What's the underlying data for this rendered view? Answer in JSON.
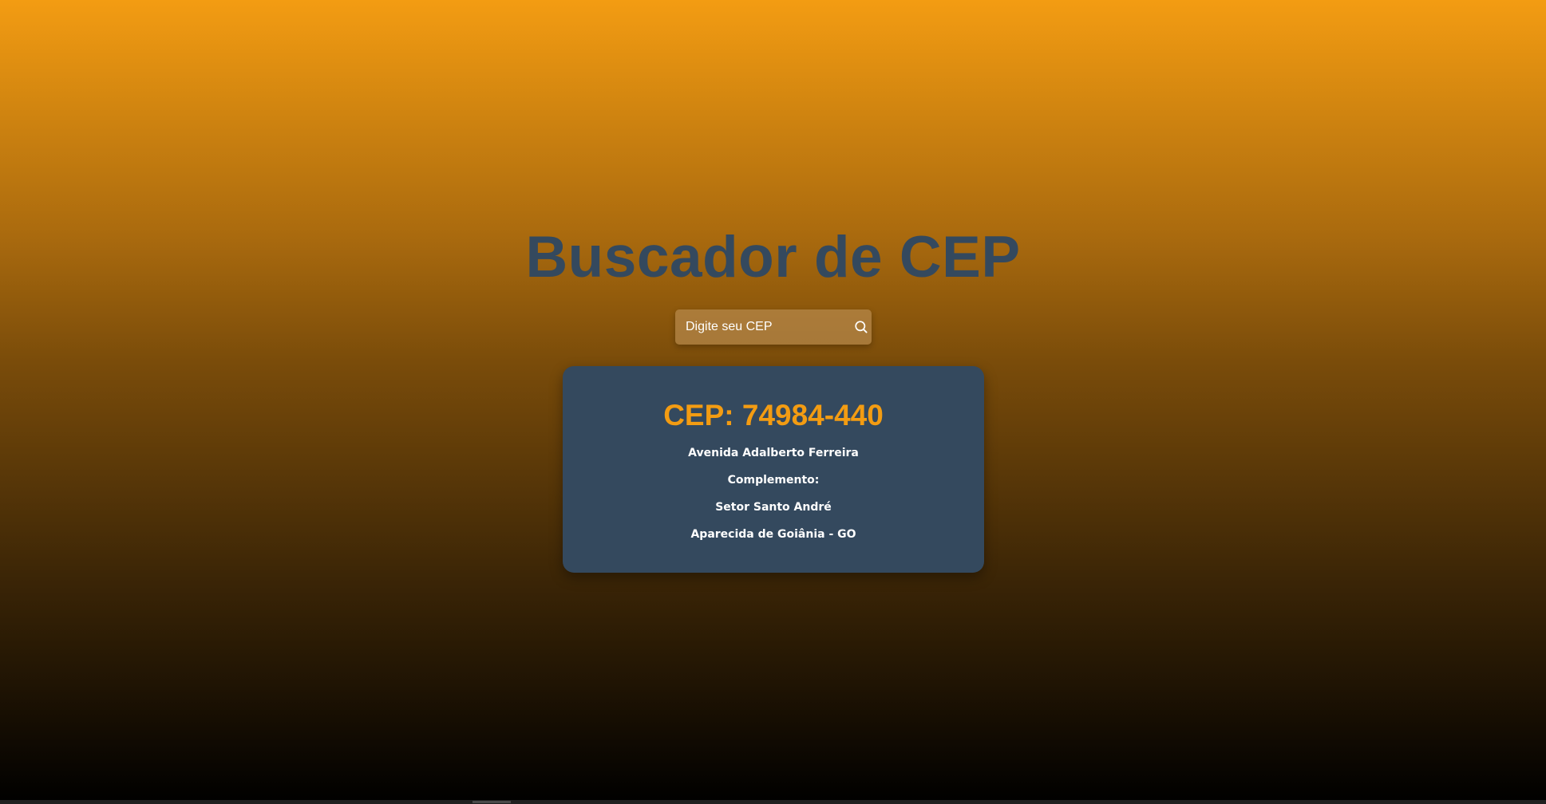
{
  "app": {
    "title": "Buscador de CEP"
  },
  "search": {
    "placeholder": "Digite seu CEP",
    "value": "",
    "button_icon": "search-icon"
  },
  "result": {
    "cep_heading": "CEP: 74984-440",
    "logradouro": "Avenida Adalberto Ferreira",
    "complemento": "Complemento:",
    "bairro": "Setor Santo André",
    "localidade": "Aparecida de Goiânia - GO"
  },
  "colors": {
    "title": "#34495e",
    "accent": "#f39c12",
    "card_background": "#34495e",
    "gradient_top": "#f39c12",
    "gradient_bottom": "#000000"
  }
}
